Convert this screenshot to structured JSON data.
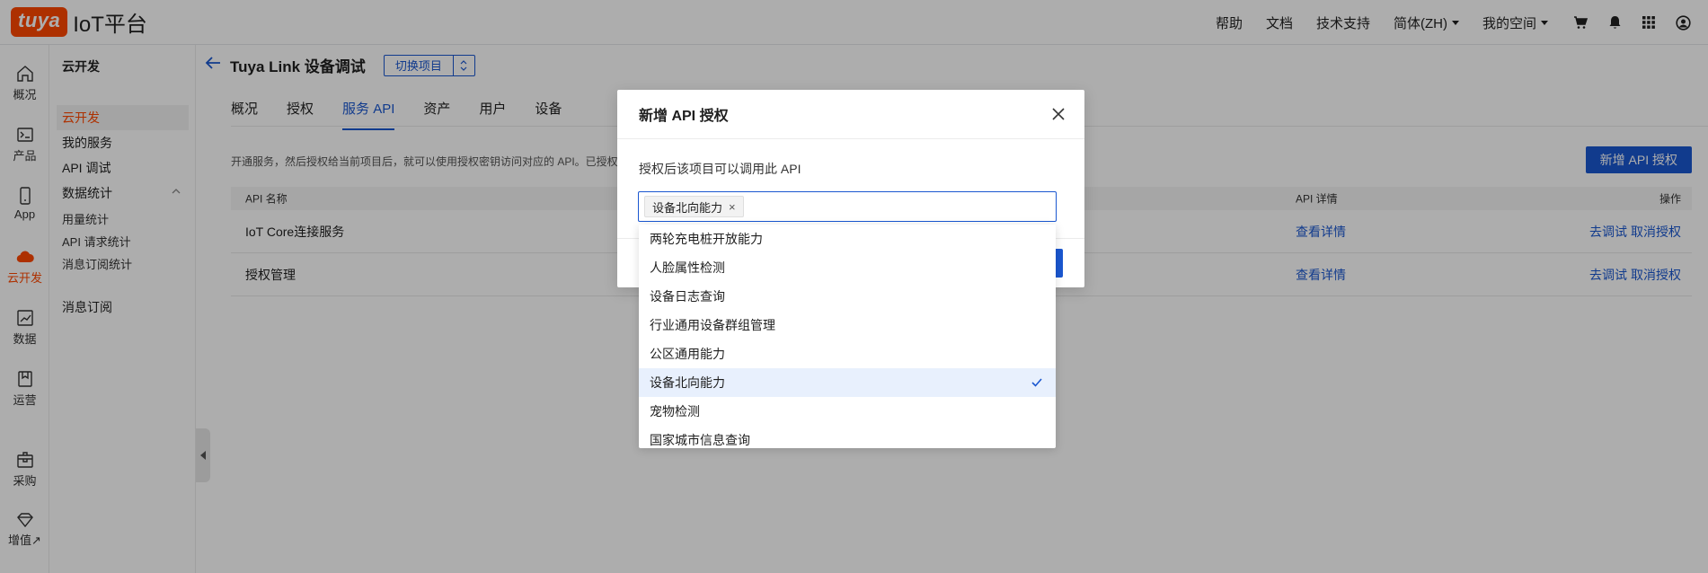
{
  "topbar": {
    "logo_mark": "tuya",
    "logo_text": "IoT平台",
    "nav": [
      "帮助",
      "文档",
      "技术支持"
    ],
    "language": "简体(ZH)",
    "space": "我的空间",
    "icons": [
      "cart-icon",
      "bell-icon",
      "apps-grid-icon",
      "user-icon"
    ]
  },
  "rail": {
    "items": [
      {
        "label": "概况",
        "icon": "home-icon"
      },
      {
        "label": "产品",
        "icon": "terminal-icon"
      },
      {
        "label": "App",
        "icon": "phone-icon"
      },
      {
        "label": "云开发",
        "icon": "cloud-icon"
      },
      {
        "label": "数据",
        "icon": "chart-icon"
      },
      {
        "label": "运营",
        "icon": "bookmark-icon"
      },
      {
        "label": "采购",
        "icon": "package-icon"
      },
      {
        "label": "增值↗",
        "icon": "diamond-icon"
      }
    ]
  },
  "subnav": {
    "title": "云开发",
    "items": [
      "云开发",
      "我的服务",
      "API 调试",
      "数据统计",
      "用量统计",
      "API 请求统计",
      "消息订阅统计",
      "消息订阅"
    ]
  },
  "main": {
    "project_title": "Tuya Link 设备调试",
    "switch_label": "切换项目",
    "tabs": [
      "概况",
      "授权",
      "服务 API",
      "资产",
      "用户",
      "设备"
    ],
    "active_tab": "服务 API",
    "description": "开通服务，然后授权给当前项目后，就可以使用授权密钥访问对应的 API。已授权",
    "add_button": "新增 API 授权",
    "table": {
      "headers": {
        "name": "API 名称",
        "details": "API 详情",
        "actions": "操作"
      },
      "rows": [
        {
          "name": "IoT Core连接服务",
          "details": "查看详情",
          "debug": "去调试",
          "cancel": "取消授权"
        },
        {
          "name": "授权管理",
          "details": "查看详情",
          "debug": "去调试",
          "cancel": "取消授权"
        }
      ]
    }
  },
  "modal": {
    "title": "新增 API 授权",
    "label": "授权后该项目可以调用此 API",
    "selected_chip": "设备北向能力",
    "chip_remove": "×",
    "options": [
      "两轮充电桩开放能力",
      "人脸属性检测",
      "设备日志查询",
      "行业通用设备群组管理",
      "公区通用能力",
      "设备北向能力",
      "宠物检测",
      "国家城市信息查询"
    ],
    "selected_option": "设备北向能力"
  },
  "colors": {
    "brand": "#ff4800",
    "primary": "#1a57d0",
    "selected_bg": "#e8f0fd"
  }
}
